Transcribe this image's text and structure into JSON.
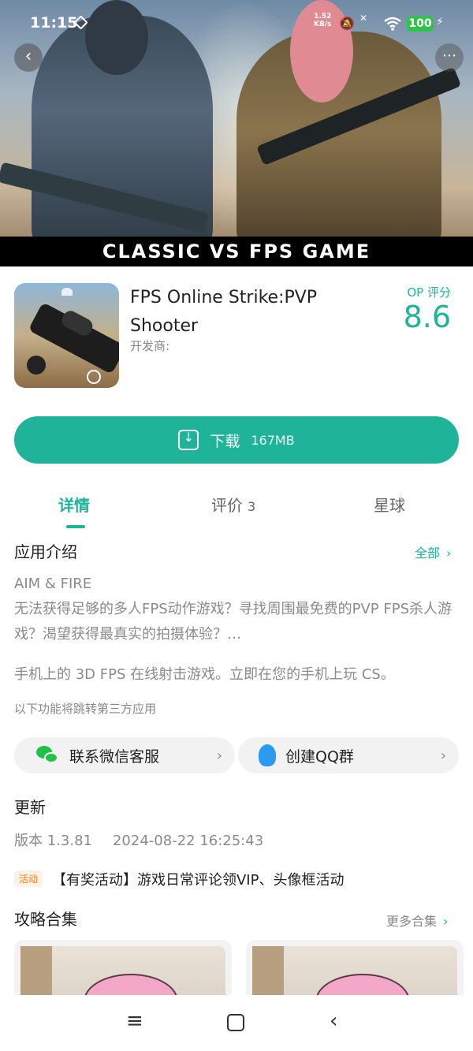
{
  "status_bar": {
    "time": "11:15",
    "net_speed": "1.52\nKB/s",
    "battery": "100"
  },
  "hero": {
    "banner": "CLASSIC VS FPS GAME"
  },
  "app": {
    "title": "FPS Online Strike:PVP Shooter",
    "developer_label": "开发商:",
    "score_label": "OP 评分",
    "score": "8.6"
  },
  "download": {
    "label": "下载",
    "size": "167MB"
  },
  "tabs": [
    {
      "label": "详情"
    },
    {
      "label": "评价",
      "count": "3"
    },
    {
      "label": "星球"
    }
  ],
  "intro": {
    "title": "应用介绍",
    "all_link": "全部",
    "line1": "AIM & FIRE",
    "para1": "无法获得足够的多人FPS动作游戏？寻找周围最免费的PVP FPS杀人游戏？渴望获得最真实的拍摄体验？…",
    "para2": "手机上的 3D FPS 在线射击游戏。立即在您的手机上玩 CS。",
    "note": "以下功能将跳转第三方应用"
  },
  "contacts": [
    {
      "label": "联系微信客服",
      "icon": "wechat-icon"
    },
    {
      "label": "创建QQ群",
      "icon": "qq-icon"
    }
  ],
  "update": {
    "title": "更新",
    "version": "版本 1.3.81",
    "date": "2024-08-22 16:25:43"
  },
  "activity": {
    "badge": "活动",
    "text": "【有奖活动】游戏日常评论领VIP、头像框活动"
  },
  "guides": {
    "title": "攻略合集",
    "more_link": "更多合集"
  },
  "colors": {
    "accent": "#1fb39a",
    "activity_badge": "#ff7a1a"
  }
}
